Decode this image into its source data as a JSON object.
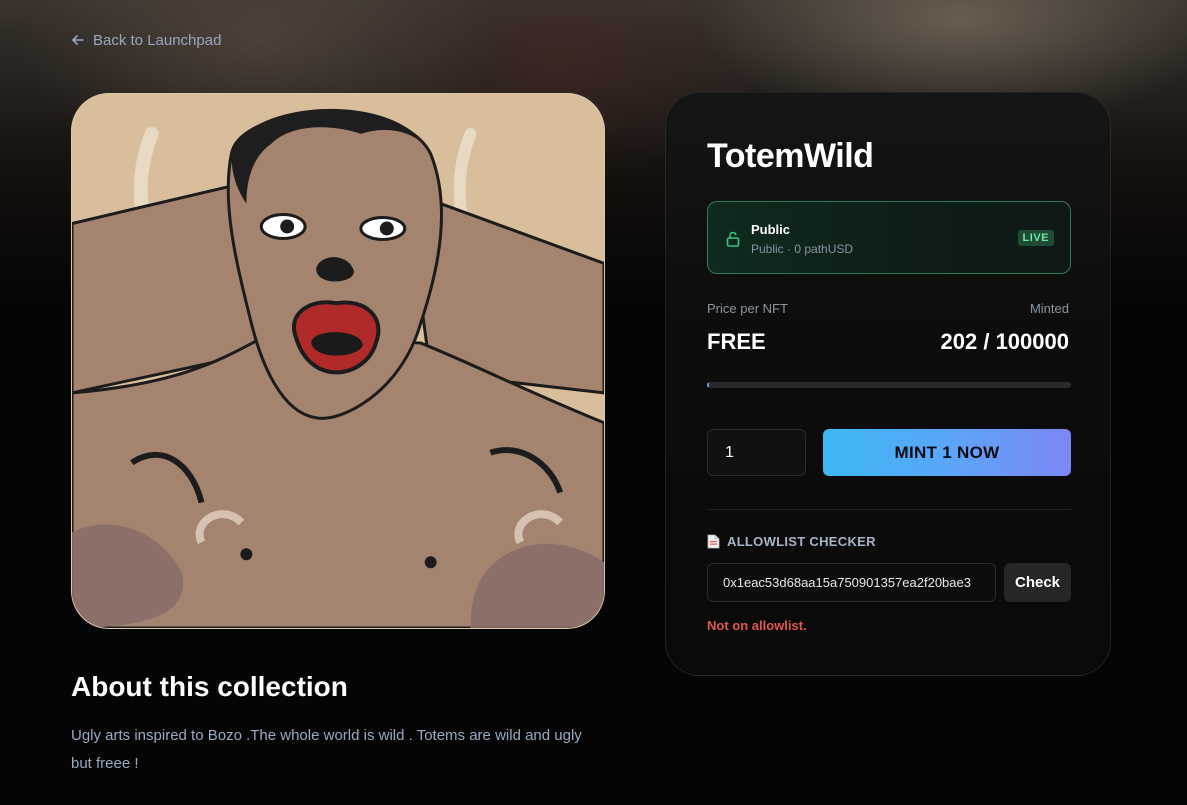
{
  "nav": {
    "back_label": "Back to Launchpad",
    "back_icon": "arrow-left-icon"
  },
  "collection": {
    "name": "TotemWild",
    "artwork_icon": "cartoon-portrait-image"
  },
  "phase": {
    "name": "Public",
    "subtitle": "Public · 0 pathUSD",
    "badge": "LIVE",
    "icon": "unlock-icon"
  },
  "pricing": {
    "price_label": "Price per NFT",
    "price_value": "FREE",
    "minted_label": "Minted",
    "minted_value": "202 / 100000",
    "minted_count": 202,
    "total_supply": 100000
  },
  "mint": {
    "quantity": "1",
    "button_label": "MINT 1 NOW"
  },
  "allowlist": {
    "title": "ALLOWLIST CHECKER",
    "icon": "document-icon",
    "address_value": "0x1eac53d68aa15a750901357ea2f20bae3",
    "check_label": "Check",
    "status": "Not on allowlist."
  },
  "about": {
    "title": "About this collection",
    "description": "Ugly arts inspired to Bozo .The whole world is wild . Totems are wild and ugly but freee !"
  },
  "colors": {
    "live_border": "#2f7d58",
    "mint_gradient_start": "#3db8f5",
    "mint_gradient_end": "#7e86f6",
    "error": "#e2574f",
    "muted_text": "#9ba9c2"
  }
}
